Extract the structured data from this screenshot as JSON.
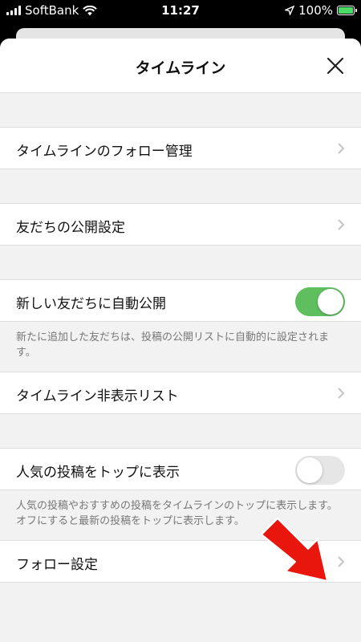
{
  "status_bar": {
    "carrier": "SoftBank",
    "time": "11:27",
    "battery": "100%"
  },
  "sheet": {
    "title": "タイムライン"
  },
  "rows": {
    "follow_manage": {
      "label": "タイムラインのフォロー管理"
    },
    "friends_publish": {
      "label": "友だちの公開設定"
    },
    "auto_publish": {
      "label": "新しい友だちに自動公開",
      "toggle": "on",
      "note": "新たに追加した友だちは、投稿の公開リストに自動的に設定されます。"
    },
    "hidden_list": {
      "label": "タイムライン非表示リスト"
    },
    "popular_top": {
      "label": "人気の投稿をトップに表示",
      "toggle": "off",
      "note": "人気の投稿やおすすめの投稿をタイムラインのトップに表示します。オフにすると最新の投稿をトップに表示します。"
    },
    "follow_settings": {
      "label": "フォロー設定"
    }
  },
  "colors": {
    "toggle_on": "#5fbf5f",
    "toggle_off": "#e6e6e6",
    "arrow": "#e8160c"
  },
  "icons": {
    "close": "close-icon",
    "chevron": "chevron-right-icon",
    "arrow": "red-arrow-icon"
  }
}
